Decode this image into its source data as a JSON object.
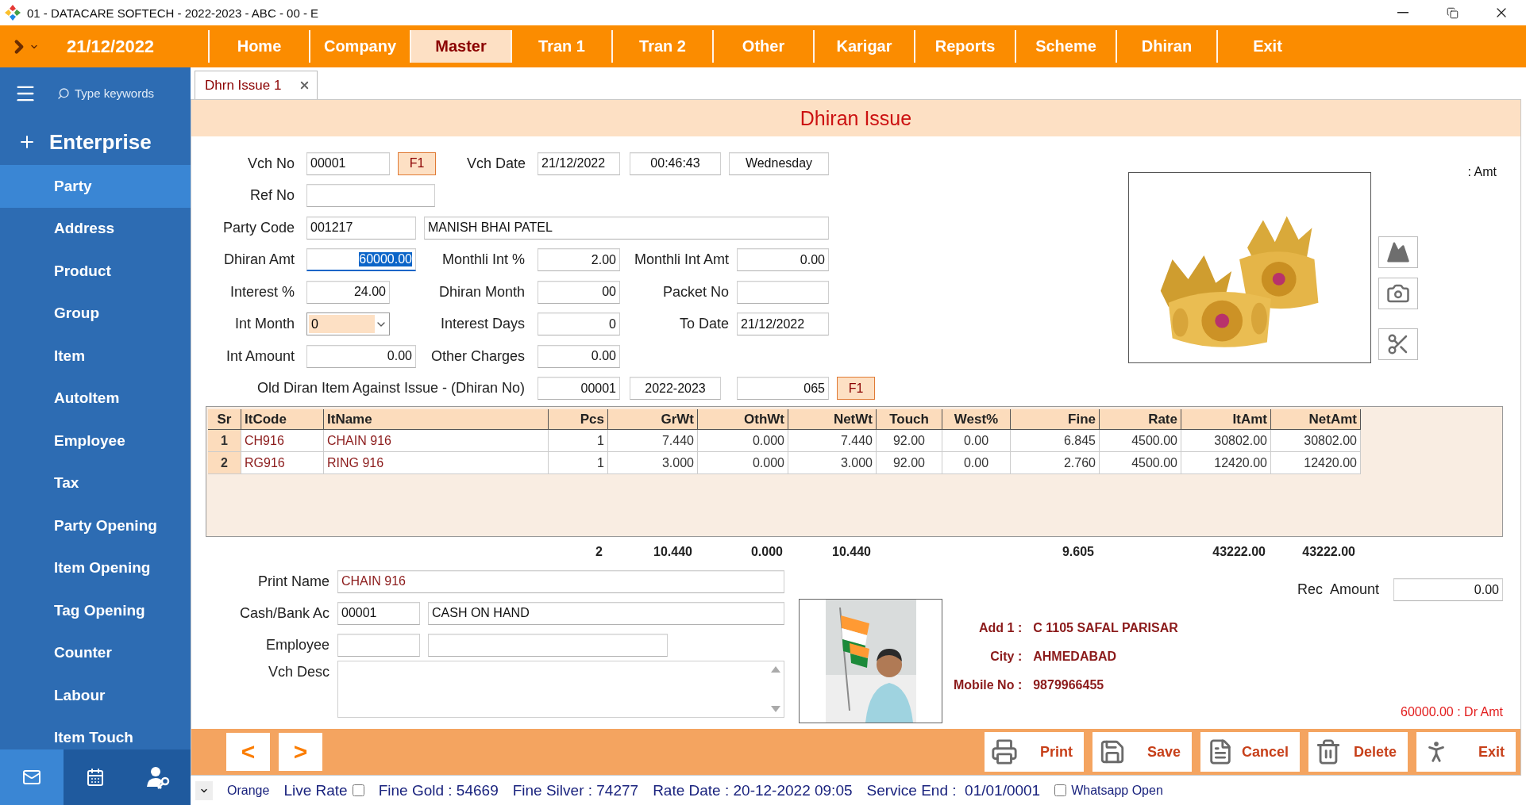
{
  "window": {
    "title": "01 - DATACARE SOFTECH - 2022-2023 - ABC - 00 - E"
  },
  "menu_bar": {
    "date": "21/12/2022",
    "items": [
      {
        "label": "Home",
        "selected": false
      },
      {
        "label": "Company",
        "selected": false
      },
      {
        "label": "Master",
        "selected": true
      },
      {
        "label": "Tran 1",
        "selected": false
      },
      {
        "label": "Tran 2",
        "selected": false
      },
      {
        "label": "Other",
        "selected": false
      },
      {
        "label": "Karigar",
        "selected": false
      },
      {
        "label": "Reports",
        "selected": false
      },
      {
        "label": "Scheme",
        "selected": false
      },
      {
        "label": "Dhiran",
        "selected": false
      },
      {
        "label": "Exit",
        "selected": false
      }
    ]
  },
  "sidebar": {
    "search": {
      "placeholder": "Type keywords"
    },
    "section": "Enterprise",
    "items": [
      {
        "label": "Party",
        "selected": true
      },
      {
        "label": "Address",
        "selected": false
      },
      {
        "label": "Product",
        "selected": false
      },
      {
        "label": "Group",
        "selected": false
      },
      {
        "label": "Item",
        "selected": false
      },
      {
        "label": "AutoItem",
        "selected": false
      },
      {
        "label": "Employee",
        "selected": false
      },
      {
        "label": "Tax",
        "selected": false
      },
      {
        "label": "Party Opening",
        "selected": false
      },
      {
        "label": "Item Opening",
        "selected": false
      },
      {
        "label": "Tag Opening",
        "selected": false
      },
      {
        "label": "Counter",
        "selected": false
      },
      {
        "label": "Labour",
        "selected": false
      },
      {
        "label": "Item Touch",
        "selected": false
      }
    ]
  },
  "tabs": [
    {
      "label": "Dhrn Issue 1",
      "selected": true
    }
  ],
  "form": {
    "title": "Dhiran Issue",
    "amount_caption": ": Amt",
    "vch_no": {
      "label": "Vch No",
      "value": "00001",
      "button": "F1"
    },
    "vch_date": {
      "label": "Vch Date",
      "date": "21/12/2022",
      "time": "00:46:43",
      "day": "Wednesday"
    },
    "ref_no": {
      "label": "Ref No"
    },
    "party_code": {
      "label": "Party Code",
      "code": "001217",
      "name": "MANISH BHAI PATEL"
    },
    "dhiran_amt": {
      "label": "Dhiran Amt",
      "value": "60000.00",
      "focused": true
    },
    "monthly_int_pct": {
      "label": "Monthli Int %",
      "value": "2.00"
    },
    "monthly_int_amt": {
      "label": "Monthli Int Amt",
      "value": "0.00"
    },
    "interest_pct": {
      "label": "Interest %",
      "value": "24.00"
    },
    "dhiran_month": {
      "label": "Dhiran Month",
      "value": "00"
    },
    "packet_no": {
      "label": "Packet No"
    },
    "int_month": {
      "label": "Int Month",
      "value": "0"
    },
    "interest_days": {
      "label": "Interest Days",
      "value": "0"
    },
    "to_date": {
      "label": "To Date",
      "value": "21/12/2022"
    },
    "int_amount": {
      "label": "Int Amount",
      "value": "0.00"
    },
    "other_charges": {
      "label": "Other Charges",
      "value": "0.00"
    },
    "old_item": {
      "label": "Old Diran Item Against Issue - (Dhiran No)",
      "number": "00001",
      "year": "2022-2023",
      "value": "065",
      "button": "F1"
    }
  },
  "table": {
    "columns": [
      "Sr",
      "ItCode",
      "ItName",
      "Pcs",
      "GrWt",
      "OthWt",
      "NetWt",
      "Touch",
      "West%",
      "Fine",
      "Rate",
      "ItAmt",
      "NetAmt"
    ],
    "rows": [
      [
        "1",
        "CH916",
        "CHAIN 916",
        "1",
        "7.440",
        "0.000",
        "7.440",
        "92.00",
        "0.00",
        "6.845",
        "4500.00",
        "30802.00",
        "30802.00"
      ],
      [
        "2",
        "RG916",
        "RING 916",
        "1",
        "3.000",
        "0.000",
        "3.000",
        "92.00",
        "0.00",
        "2.760",
        "4500.00",
        "12420.00",
        "12420.00"
      ]
    ],
    "totals": {
      "pcs": "2",
      "grwt": "10.440",
      "othwt": "0.000",
      "netwt": "10.440",
      "fine": "9.605",
      "itamt": "43222.00",
      "netamt": "43222.00"
    }
  },
  "details": {
    "print_name": {
      "label": "Print Name",
      "value": "CHAIN 916"
    },
    "cash_bank": {
      "label": "Cash/Bank Ac",
      "code": "00001",
      "name": "CASH ON HAND"
    },
    "employee": {
      "label": "Employee"
    },
    "vch_desc": {
      "label": "Vch Desc"
    },
    "rec_amount": {
      "label": "Rec  Amount",
      "value": "0.00"
    },
    "party_info": [
      {
        "label": "Add 1 :",
        "value": "C 1105 SAFAL PARISAR"
      },
      {
        "label": "City :",
        "value": "AHMEDABAD"
      },
      {
        "label": "Mobile No :",
        "value": "9879966455"
      }
    ],
    "balance": "60000.00 : Dr Amt"
  },
  "toolbar": {
    "nav": [
      "<",
      ">"
    ],
    "actions": [
      {
        "kind": "print",
        "label": "Print"
      },
      {
        "kind": "save",
        "label": "Save"
      },
      {
        "kind": "cancel",
        "label": "Cancel"
      },
      {
        "kind": "delete",
        "label": "Delete"
      },
      {
        "kind": "exit",
        "label": "Exit"
      }
    ]
  },
  "status_bar": {
    "theme": "Orange",
    "live_rate": {
      "label": "Live Rate",
      "checked": false
    },
    "fine_gold": "Fine Gold : 54669",
    "fine_silver": "Fine Silver : 74277",
    "rate_date": "Rate Date : 20-12-2022 09:05",
    "service_end": "Service End :  01/01/0001",
    "whatsapp": {
      "label": "Whatsapp Open",
      "checked": false
    }
  }
}
